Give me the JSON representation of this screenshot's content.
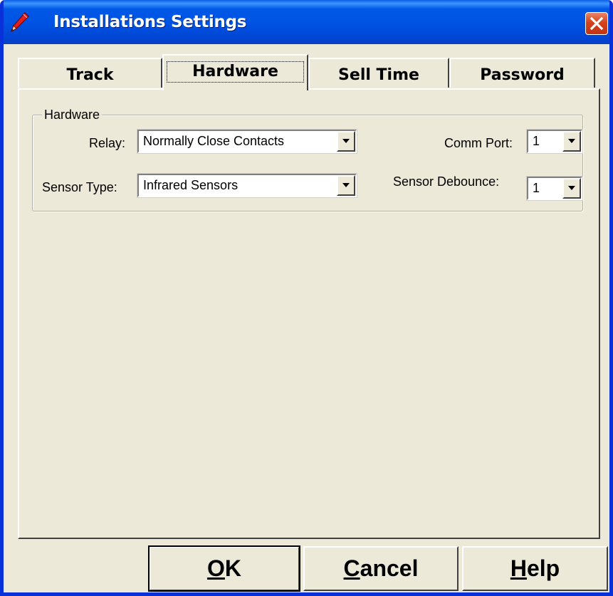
{
  "window": {
    "title": "Installations Settings",
    "icon": "pencil-icon",
    "close_icon": "close-icon"
  },
  "tabs": [
    {
      "label": "Track",
      "selected": false
    },
    {
      "label": "Hardware",
      "selected": true
    },
    {
      "label": "Sell Time",
      "selected": false
    },
    {
      "label": "Password",
      "selected": false
    }
  ],
  "hardware_group": {
    "legend": "Hardware",
    "relay": {
      "label": "Relay:",
      "value": "Normally Close Contacts"
    },
    "sensor_type": {
      "label": "Sensor Type:",
      "value": "Infrared Sensors"
    },
    "comm_port": {
      "label": "Comm Port:",
      "value": "1"
    },
    "sensor_debounce": {
      "label": "Sensor Debounce:",
      "value": "1"
    }
  },
  "buttons": {
    "ok": {
      "access_key": "O",
      "rest": "K"
    },
    "cancel": {
      "access_key": "C",
      "rest": "ancel"
    },
    "help": {
      "access_key": "H",
      "rest": "elp"
    }
  },
  "colors": {
    "titlebar": "#0054e3",
    "dialog_face": "#ece9d8",
    "close_button": "#d4431d"
  }
}
